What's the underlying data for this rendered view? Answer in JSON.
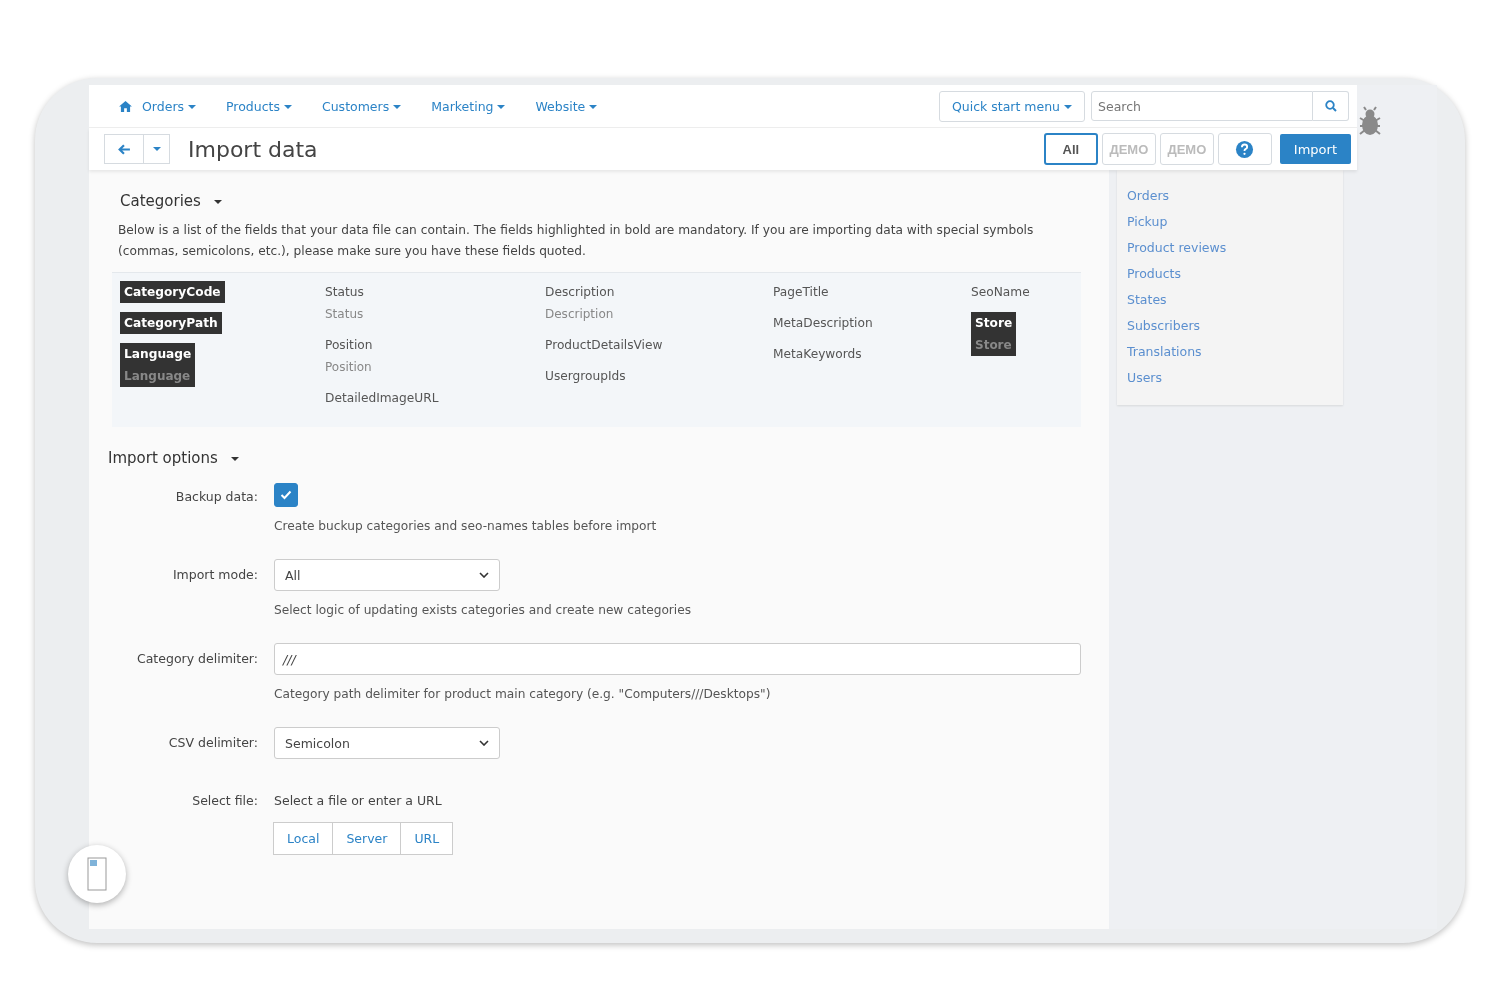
{
  "nav": {
    "items": [
      {
        "label": "Orders"
      },
      {
        "label": "Products"
      },
      {
        "label": "Customers"
      },
      {
        "label": "Marketing"
      },
      {
        "label": "Website"
      }
    ],
    "quick_start": "Quick start menu",
    "search": {
      "placeholder": "Search"
    }
  },
  "title_bar": {
    "title": "Import data",
    "toolbar": [
      {
        "kind": "preset",
        "label": "All",
        "selected": true
      },
      {
        "kind": "preset",
        "label": "ДЕМО",
        "selected": false
      },
      {
        "kind": "preset",
        "label": "ДЕМО",
        "selected": false
      },
      {
        "kind": "help"
      },
      {
        "kind": "primary",
        "label": "Import"
      }
    ]
  },
  "categories": {
    "title": "Categories",
    "description": "Below is a list of the fields that your data file can contain. The fields highlighted in bold are mandatory. If you are importing data with special symbols (commas, semicolons, etc.), please make sure you have these fields quoted.",
    "columns": [
      {
        "fields": [
          {
            "name": "CategoryCode",
            "mandatory": true
          },
          {
            "name": "CategoryPath",
            "mandatory": true
          },
          {
            "name": "Language",
            "mandatory": true,
            "alt": "Language"
          }
        ]
      },
      {
        "fields": [
          {
            "name": "Status",
            "mandatory": false,
            "alt": "Status"
          },
          {
            "name": "Position",
            "mandatory": false,
            "alt": "Position"
          },
          {
            "name": "DetailedImageURL",
            "mandatory": false
          }
        ]
      },
      {
        "fields": [
          {
            "name": "Description",
            "mandatory": false,
            "alt": "Description"
          },
          {
            "name": "ProductDetailsView",
            "mandatory": false
          },
          {
            "name": "UsergroupIds",
            "mandatory": false
          }
        ]
      },
      {
        "fields": [
          {
            "name": "PageTitle",
            "mandatory": false
          },
          {
            "name": "MetaDescription",
            "mandatory": false
          },
          {
            "name": "MetaKeywords",
            "mandatory": false
          }
        ]
      },
      {
        "fields": [
          {
            "name": "SeoName",
            "mandatory": false
          },
          {
            "name": "Store",
            "mandatory": true,
            "alt": "Store"
          }
        ]
      }
    ]
  },
  "import_options": {
    "title": "Import options",
    "rows": [
      {
        "kind": "checkbox",
        "label": "Backup data:",
        "checked": true,
        "help": "Create buckup categories and seo-names tables before import"
      },
      {
        "kind": "select",
        "label": "Import mode:",
        "value": "All",
        "help": "Select logic of updating exists categories and create new categories"
      },
      {
        "kind": "text",
        "label": "Category delimiter:",
        "value": "///",
        "help": "Category path delimiter for product main category (e.g. \"Computers///Desktops\")"
      },
      {
        "kind": "select",
        "label": "CSV delimiter:",
        "value": "Semicolon"
      },
      {
        "kind": "file",
        "label": "Select file:",
        "value": "Select a file or enter a URL",
        "buttons": [
          "Local",
          "Server",
          "URL"
        ]
      }
    ]
  },
  "sidebar": {
    "items": [
      {
        "label": "Orders"
      },
      {
        "label": "Pickup"
      },
      {
        "label": "Product reviews"
      },
      {
        "label": "Products"
      },
      {
        "label": "States"
      },
      {
        "label": "Subscribers"
      },
      {
        "label": "Translations"
      },
      {
        "label": "Users"
      }
    ]
  }
}
